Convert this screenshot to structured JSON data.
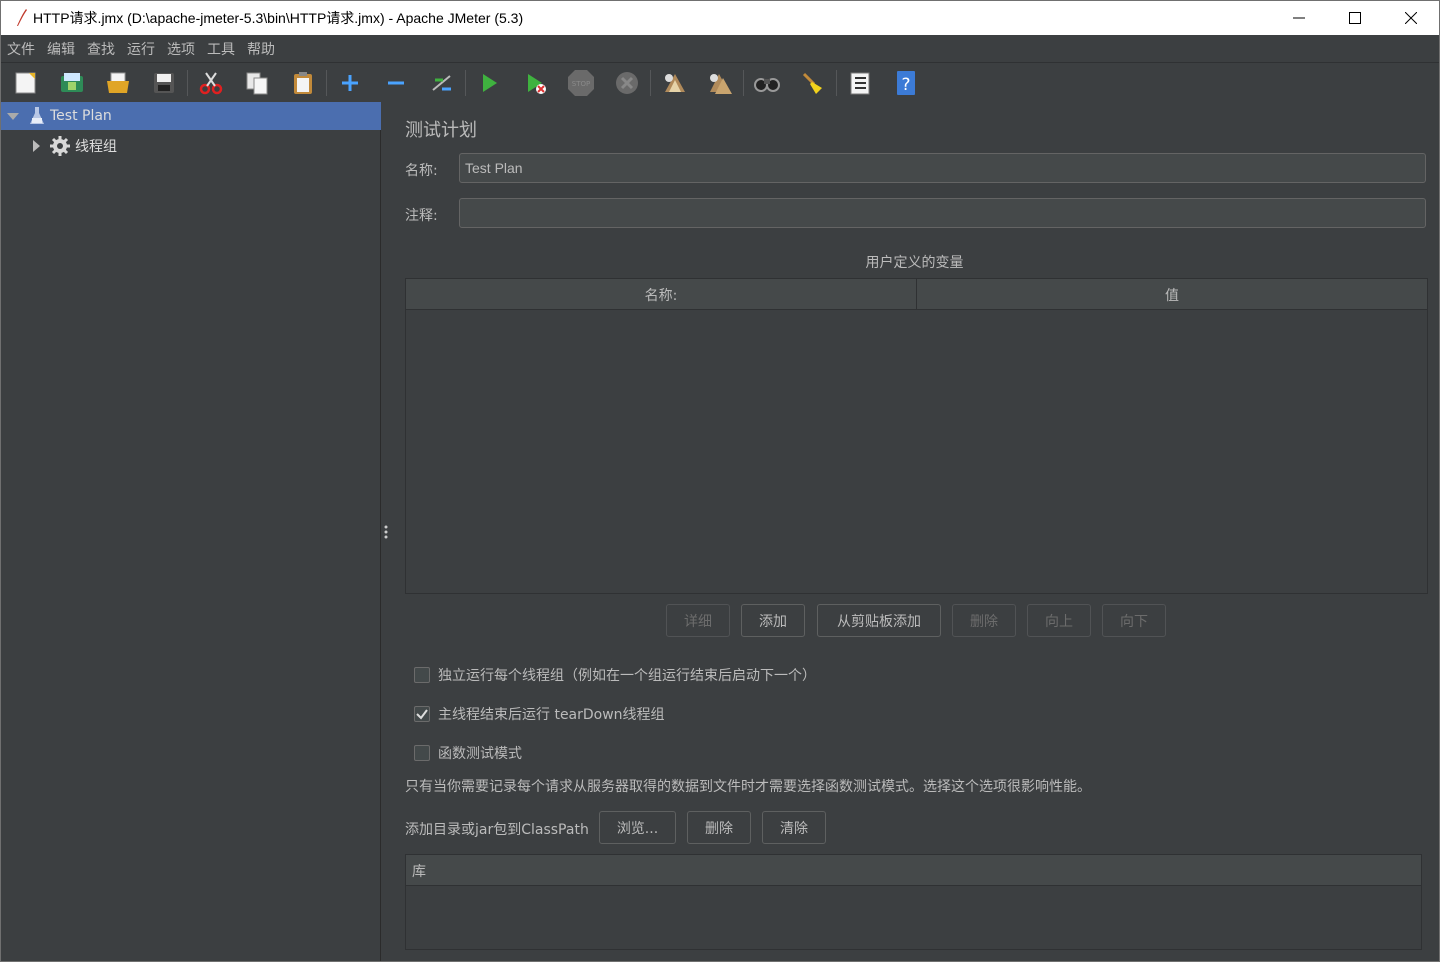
{
  "window": {
    "title": "HTTP请求.jmx (D:\\apache-jmeter-5.3\\bin\\HTTP请求.jmx) - Apache JMeter (5.3)",
    "controls": [
      "minimize-icon",
      "maximize-icon",
      "close-icon"
    ]
  },
  "menu": [
    "文件",
    "编辑",
    "查找",
    "运行",
    "选项",
    "工具",
    "帮助"
  ],
  "toolbar": {
    "icons": [
      "new-icon",
      "templates-icon",
      "open-icon",
      "save-icon",
      "cut-icon",
      "copy-icon",
      "paste-icon",
      "expand-icon",
      "collapse-icon",
      "toggle-icon",
      "start-icon",
      "start-no-pause-icon",
      "stop-icon",
      "shutdown-icon",
      "clear-icon",
      "clear-all-icon",
      "search-icon",
      "reset-search-icon",
      "function-helper-icon",
      "help-icon"
    ],
    "stop_label": "STOP"
  },
  "tree": {
    "items": [
      {
        "label": "Test Plan",
        "selected": true
      },
      {
        "label": "线程组",
        "selected": false
      }
    ]
  },
  "main": {
    "section_title": "测试计划",
    "name_label": "名称:",
    "name_value": "Test Plan",
    "comment_label": "注释:",
    "comment_value": "",
    "variables_title": "用户定义的变量",
    "variables_columns": [
      "名称:",
      "值"
    ],
    "table_buttons": [
      {
        "label": "详细",
        "enabled": false
      },
      {
        "label": "添加",
        "enabled": true
      },
      {
        "label": "从剪贴板添加",
        "enabled": true
      },
      {
        "label": "删除",
        "enabled": false
      },
      {
        "label": "向上",
        "enabled": false
      },
      {
        "label": "向下",
        "enabled": false
      }
    ],
    "options": [
      {
        "label": "独立运行每个线程组（例如在一个组运行结束后启动下一个）",
        "checked": false
      },
      {
        "label": "主线程结束后运行 tearDown线程组",
        "checked": true
      },
      {
        "label": "函数测试模式",
        "checked": false
      }
    ],
    "functional_note": "只有当你需要记录每个请求从服务器取得的数据到文件时才需要选择函数测试模式。选择这个选项很影响性能。",
    "classpath_label": "添加目录或jar包到ClassPath",
    "classpath_buttons": [
      "浏览...",
      "删除",
      "清除"
    ],
    "library_column": "库"
  },
  "colors": {
    "background": "#3c3f41",
    "selection": "#4b6eaf",
    "field": "#45494a",
    "start_green": "#3fb23f",
    "help_blue": "#3c7bd6"
  }
}
